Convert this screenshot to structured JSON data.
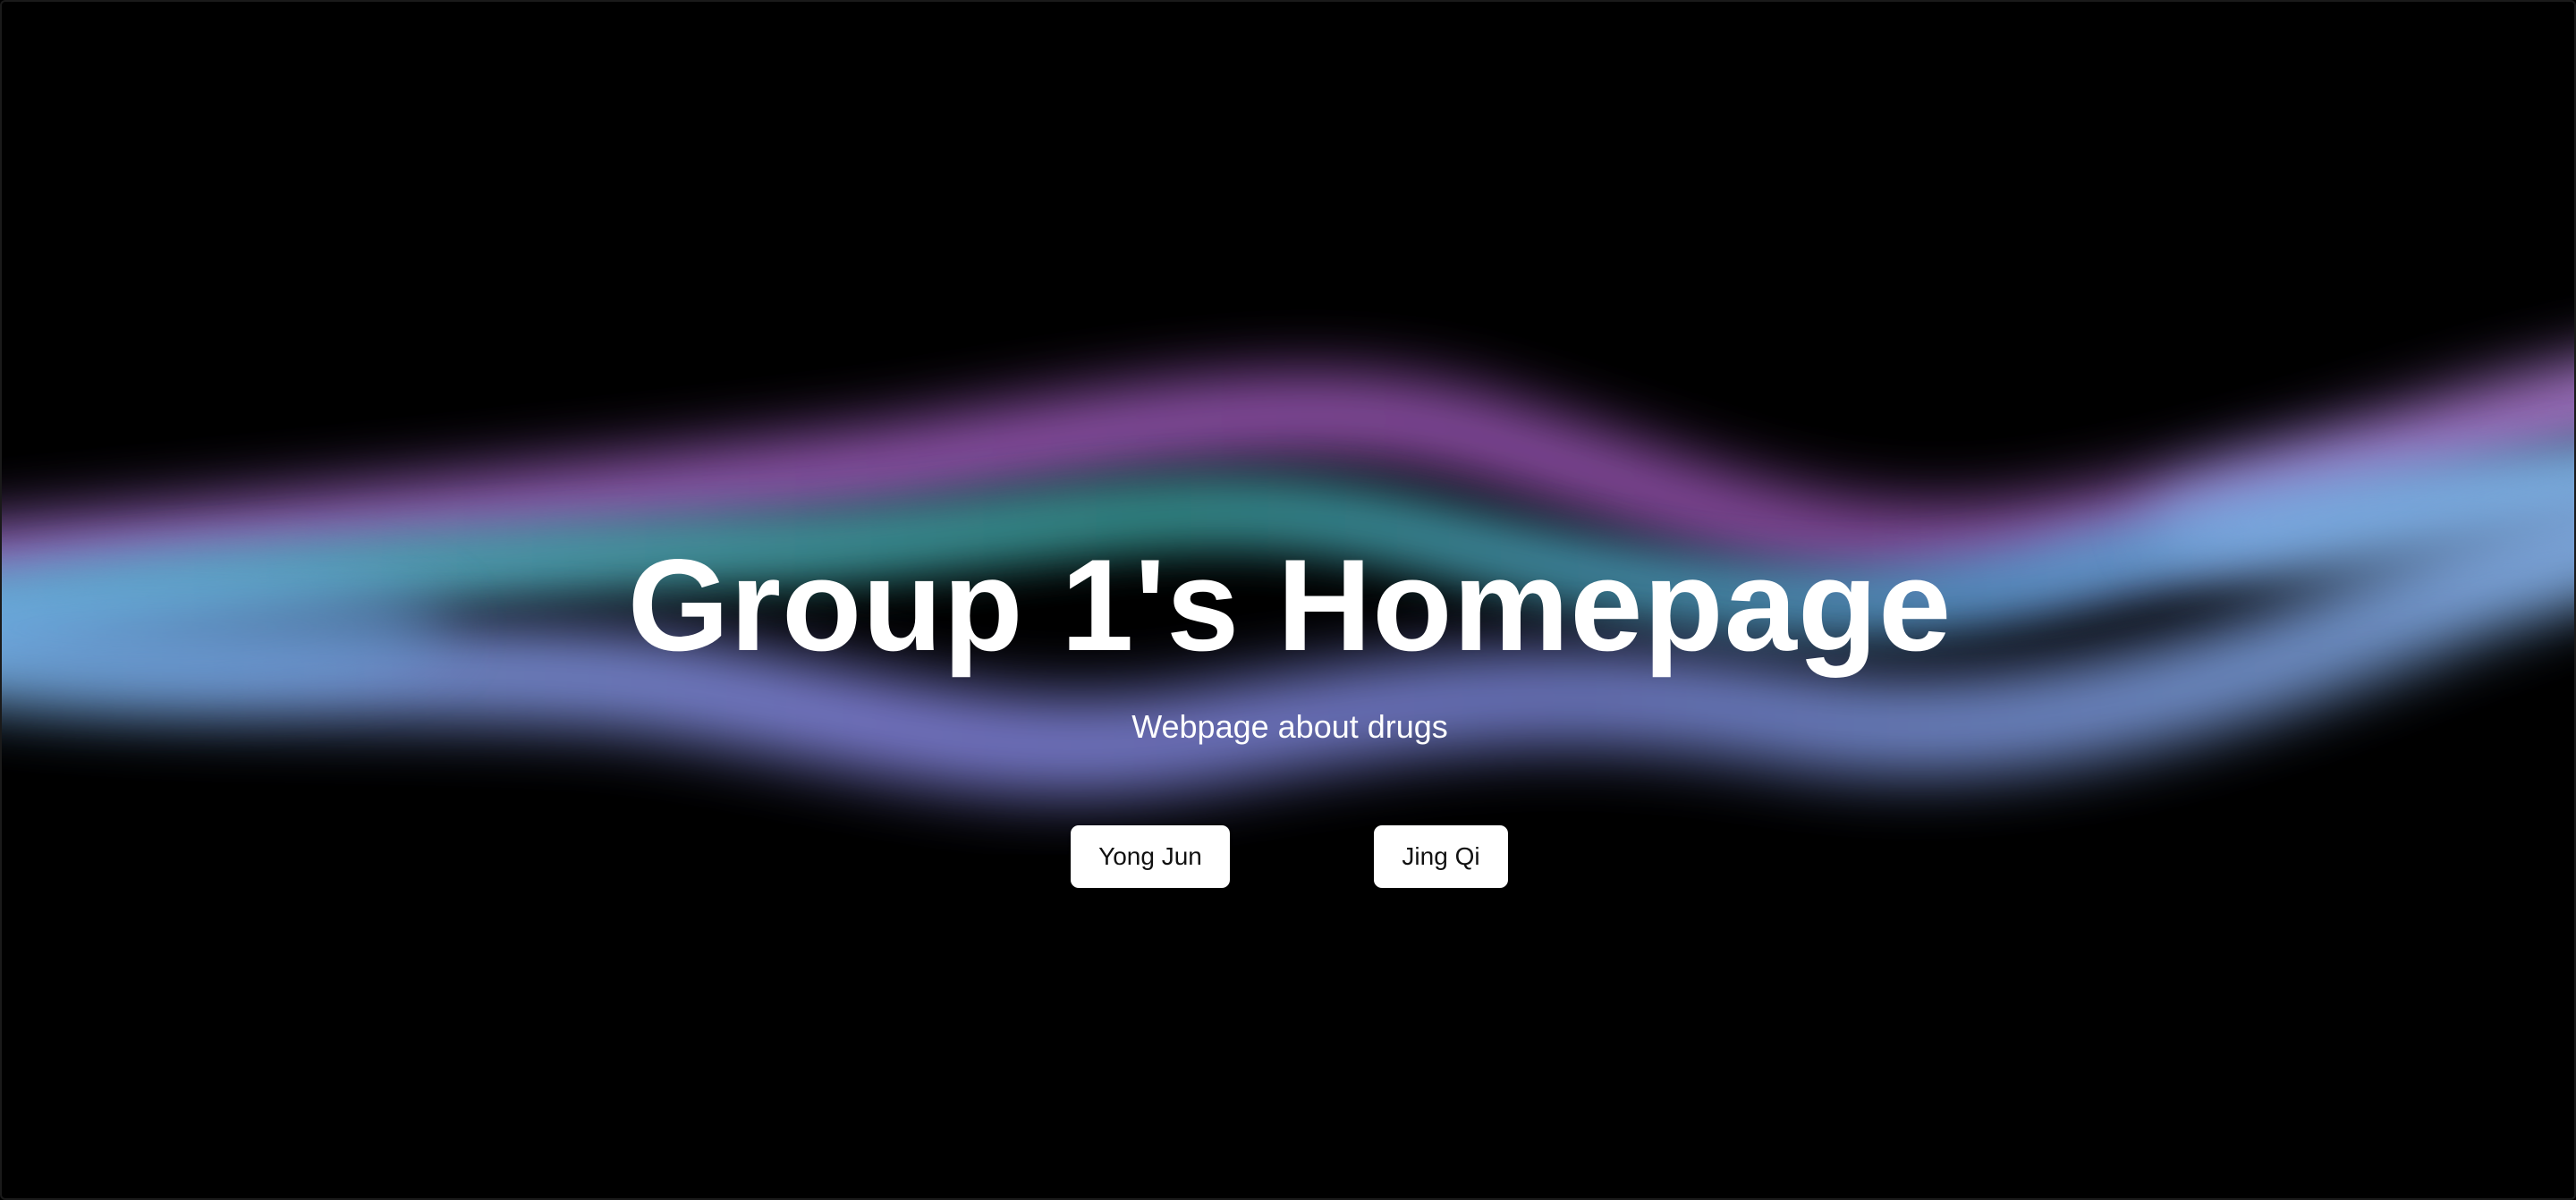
{
  "hero": {
    "title": "Group 1's Homepage",
    "subtitle": "Webpage about drugs"
  },
  "buttons": [
    {
      "label": "Yong Jun"
    },
    {
      "label": "Jing Qi"
    }
  ],
  "colors": {
    "background": "#000000",
    "text": "#ffffff",
    "button_bg": "#ffffff",
    "button_text": "#111111",
    "wave_purple": "#a066c8",
    "wave_teal": "#3aa6a0",
    "wave_blue": "#78aee6",
    "wave_violet": "#9a8ae8"
  }
}
